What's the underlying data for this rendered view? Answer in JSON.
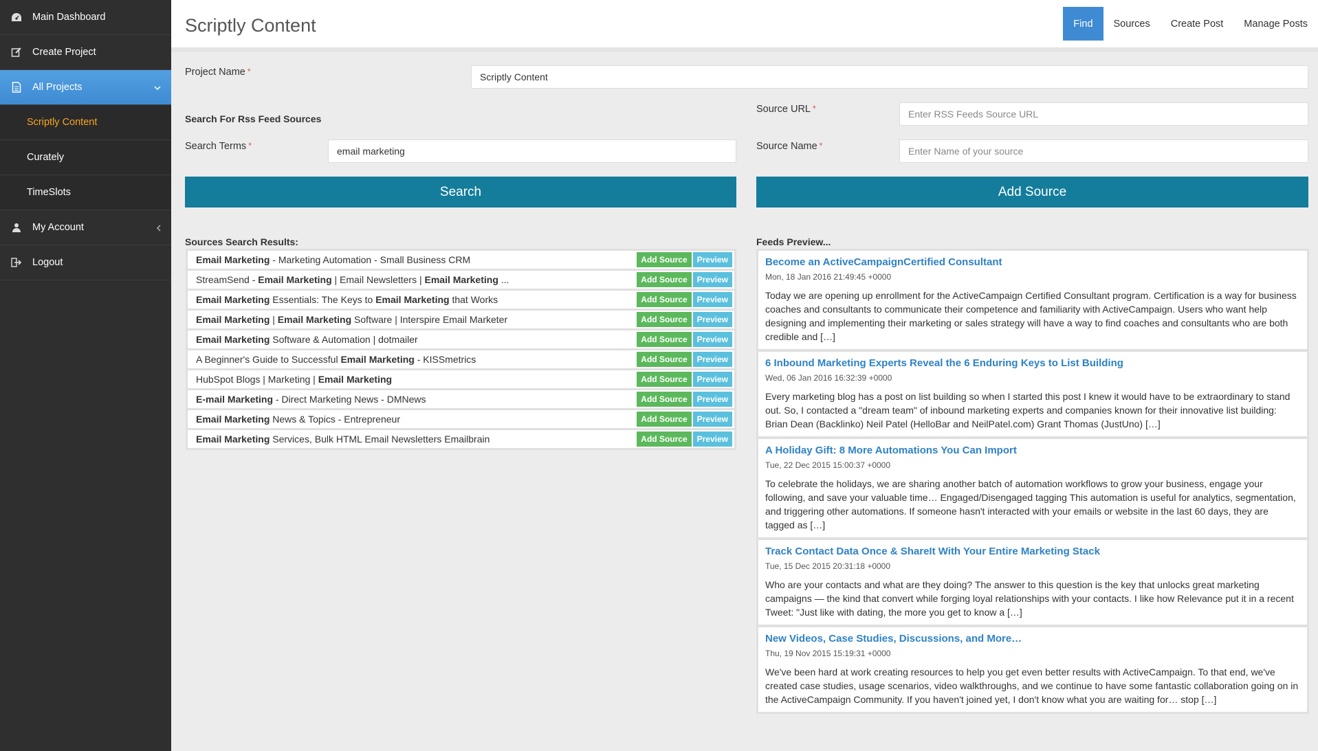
{
  "sidebar": {
    "items": [
      {
        "label": "Main Dashboard",
        "icon": "dashboard-icon"
      },
      {
        "label": "Create Project",
        "icon": "edit-icon"
      },
      {
        "label": "All Projects",
        "icon": "document-icon"
      },
      {
        "label": "My Account",
        "icon": "user-icon"
      },
      {
        "label": "Logout",
        "icon": "logout-icon"
      }
    ],
    "subitems": [
      {
        "label": "Scriptly Content"
      },
      {
        "label": "Curately"
      },
      {
        "label": "TimeSlots"
      }
    ]
  },
  "header": {
    "title": "Scriptly Content",
    "tabs": [
      {
        "label": "Find"
      },
      {
        "label": "Sources"
      },
      {
        "label": "Create Post"
      },
      {
        "label": "Manage Posts"
      }
    ]
  },
  "form": {
    "project_name_label": "Project Name",
    "project_name_value": "Scriptly Content",
    "search_heading": "Search For Rss Feed Sources",
    "search_terms_label": "Search Terms",
    "search_terms_value": "email marketing",
    "search_button": "Search",
    "source_url_label": "Source URL",
    "source_url_placeholder": "Enter RSS Feeds Source URL",
    "source_name_label": "Source Name",
    "source_name_placeholder": "Enter Name of your source",
    "add_source_button": "Add Source",
    "required_mark": "*"
  },
  "results": {
    "heading": "Sources Search Results:",
    "add_label": "Add Source",
    "preview_label": "Preview",
    "rows": [
      [
        {
          "t": "Email Marketing",
          "b": true
        },
        {
          "t": " - Marketing Automation - Small Business CRM",
          "b": false
        }
      ],
      [
        {
          "t": "StreamSend - ",
          "b": false
        },
        {
          "t": "Email Marketing",
          "b": true
        },
        {
          "t": " | Email Newsletters | ",
          "b": false
        },
        {
          "t": "Email Marketing",
          "b": true
        },
        {
          "t": " ...",
          "b": false
        }
      ],
      [
        {
          "t": "Email Marketing",
          "b": true
        },
        {
          "t": " Essentials: The Keys to ",
          "b": false
        },
        {
          "t": "Email Marketing",
          "b": true
        },
        {
          "t": " that Works",
          "b": false
        }
      ],
      [
        {
          "t": "Email Marketing",
          "b": true
        },
        {
          "t": " | ",
          "b": false
        },
        {
          "t": "Email Marketing",
          "b": true
        },
        {
          "t": " Software | Interspire Email Marketer",
          "b": false
        }
      ],
      [
        {
          "t": "Email Marketing",
          "b": true
        },
        {
          "t": " Software & Automation | dotmailer",
          "b": false
        }
      ],
      [
        {
          "t": "A Beginner's Guide to Successful ",
          "b": false
        },
        {
          "t": "Email Marketing",
          "b": true
        },
        {
          "t": " - KISSmetrics",
          "b": false
        }
      ],
      [
        {
          "t": "HubSpot Blogs | Marketing | ",
          "b": false
        },
        {
          "t": "Email Marketing",
          "b": true
        }
      ],
      [
        {
          "t": "E-mail Marketing",
          "b": true
        },
        {
          "t": " - Direct Marketing News - DMNews",
          "b": false
        }
      ],
      [
        {
          "t": "Email Marketing",
          "b": true
        },
        {
          "t": " News & Topics - Entrepreneur",
          "b": false
        }
      ],
      [
        {
          "t": "Email Marketing",
          "b": true
        },
        {
          "t": " Services, Bulk HTML Email Newsletters Emailbrain",
          "b": false
        }
      ]
    ]
  },
  "feeds": {
    "heading": "Feeds Preview...",
    "items": [
      {
        "title": "Become an ActiveCampaignCertified Consultant",
        "date": "Mon, 18 Jan 2016 21:49:45 +0000",
        "body": "Today we are opening up enrollment for the ActiveCampaign Certified Consultant program. Certification is a way for business coaches and consultants to communicate their competence and familiarity with ActiveCampaign. Users who want help designing and implementing their marketing or sales strategy will have a way to find coaches and consultants who are both credible and […]"
      },
      {
        "title": "6 Inbound Marketing Experts Reveal the 6 Enduring Keys to List Building",
        "date": "Wed, 06 Jan 2016 16:32:39 +0000",
        "body": "Every marketing blog has a post on list building so when I started this post I knew it would have to be extraordinary to stand out. So, I contacted a \"dream team\" of inbound marketing experts and companies known for their innovative list building: Brian Dean (Backlinko) Neil Patel (HelloBar and NeilPatel.com) Grant Thomas (JustUno) […]"
      },
      {
        "title": "A Holiday Gift: 8 More Automations You Can Import",
        "date": "Tue, 22 Dec 2015 15:00:37 +0000",
        "body": "To celebrate the holidays, we are sharing another batch of automation workflows to grow your business, engage your following, and save your valuable time… Engaged/Disengaged tagging This automation is useful for analytics, segmentation, and triggering other automations. If someone hasn't interacted with your emails or website in the last 60 days, they are tagged as […]"
      },
      {
        "title": "Track Contact Data Once & ShareIt With Your Entire Marketing Stack",
        "date": "Tue, 15 Dec 2015 20:31:18 +0000",
        "body": "Who are your contacts and what are they doing? The answer to this question is the key that unlocks great marketing campaigns — the kind that convert while forging loyal relationships with your contacts. I like how Relevance put it in a recent Tweet: \"Just like with dating, the more you get to know a […]"
      },
      {
        "title": "New Videos, Case Studies, Discussions, and More…",
        "date": "Thu, 19 Nov 2015 15:19:31 +0000",
        "body": "We've been hard at work creating resources to help you get even better results with ActiveCampaign. To that end, we've created case studies, usage scenarios, video walkthroughs, and we continue to have some fantastic collaboration going on in the ActiveCampaign Community. If you haven't joined yet, I don't know what you are waiting for… stop […]"
      }
    ]
  },
  "colors": {
    "sidebar_bg": "#2f2f2f",
    "active_blue": "#3f8bd3",
    "primary_button": "#137d9b",
    "add_green": "#5cb85c",
    "preview_cyan": "#5bc0de",
    "current_orange": "#f5a623",
    "link_blue": "#2f82c5"
  }
}
